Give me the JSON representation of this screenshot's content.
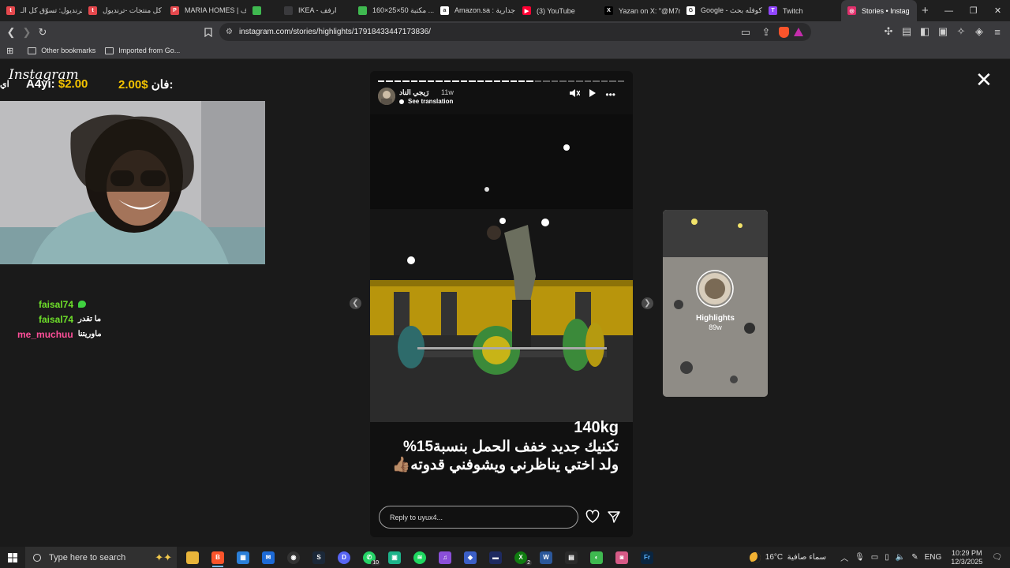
{
  "browser": {
    "tabs": [
      {
        "label": "ترنديول: تسوّق كل الـ",
        "fav_color": "#e5484d",
        "fav_glyph": "t"
      },
      {
        "label": "كل منتجات -ترنديول",
        "fav_color": "#e5484d",
        "fav_glyph": "t"
      },
      {
        "label": "MARIA HOMES | فرف",
        "fav_color": "#e5484d",
        "fav_glyph": "P"
      },
      {
        "label": "",
        "fav_color": "#3fb950",
        "fav_glyph": ""
      },
      {
        "label": "IKEA - ارفف",
        "fav_color": "#3a3a3d",
        "fav_glyph": ""
      },
      {
        "label": "مكتبة 50×25×160 ...",
        "fav_color": "#3fb950",
        "fav_glyph": ""
      },
      {
        "label": "Amazon.sa : جدارية",
        "fav_color": "#ffffff",
        "fav_glyph": "a"
      },
      {
        "label": "(3) YouTube",
        "fav_color": "#ff0033",
        "fav_glyph": "▶"
      },
      {
        "label": "Yazan on X: \"@M7m",
        "fav_color": "#000000",
        "fav_glyph": "X"
      },
      {
        "label": "Google - كوفله بحث",
        "fav_color": "#ffffff",
        "fav_glyph": "G"
      },
      {
        "label": "Twitch",
        "fav_color": "#9146ff",
        "fav_glyph": "T"
      },
      {
        "label": "Stories • Instag",
        "fav_color": "#e1306c",
        "fav_glyph": "◎",
        "active": true
      }
    ],
    "url": "instagram.com/stories/highlights/17918433447173836/",
    "bookmarks": [
      "Other bookmarks",
      "Imported from Go..."
    ]
  },
  "overlay": {
    "logo": "Instagram",
    "price_left_label": "A4yi:",
    "price_left_value": "$2.00",
    "price_right_value": "2.00$",
    "price_right_label": "فان:",
    "price_edge": "اي",
    "chat": [
      {
        "user": "faisal74",
        "user_color": "#6ee02a",
        "msg": "",
        "emote": true
      },
      {
        "user": "faisal74",
        "user_color": "#6ee02a",
        "msg": "ما تقدر"
      },
      {
        "user": "me_muchuu",
        "user_color": "#ff4f9a",
        "msg": "ماوريتنا"
      }
    ]
  },
  "story": {
    "username": "رَيجي الناد",
    "time_ago": "11w",
    "see_translation": "See translation",
    "caption_line1": "140kg",
    "caption_line2": "تكنيك جديد خفف الحمل بنسبة15%",
    "caption_line3": "ولد اختي يناظرني ويشوفني قدوته👍🏽",
    "reply_placeholder": "Reply to uyux4...",
    "progress_segments": 30,
    "progress_done": 19
  },
  "next_preview": {
    "title": "Highlights",
    "time_ago": "89w"
  },
  "taskbar": {
    "search_placeholder": "Type here to search",
    "weather_temp": "16°C",
    "weather_desc": "سماء صافية",
    "lang": "ENG",
    "time": "10:29 PM",
    "date": "12/3/2025"
  }
}
